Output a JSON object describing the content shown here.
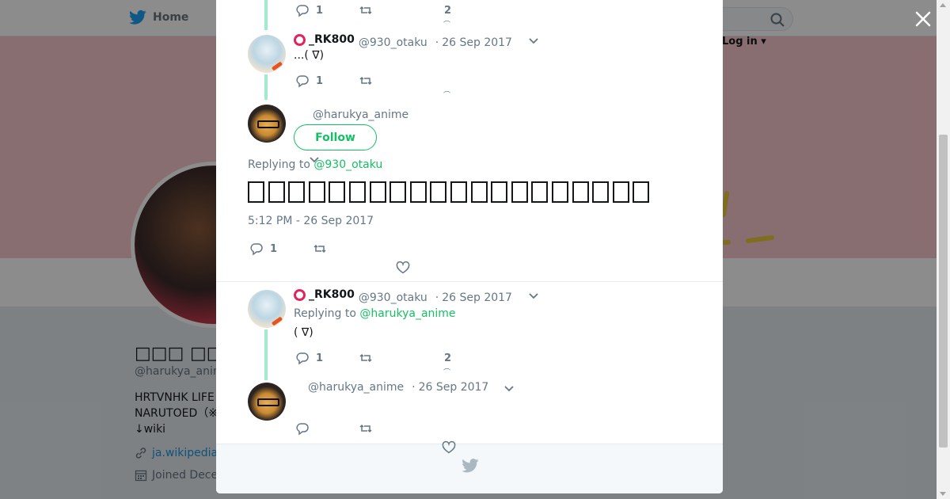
{
  "background": {
    "nav_home": "Home",
    "login": "Log in",
    "profile_name": "□□□ □□",
    "profile_handle": "@harukya_anim",
    "bio_line1": "HRTVNHK LIFE",
    "bio_line2": "NARUTOED（※",
    "bio_line3": "↓wiki",
    "link": "ja.wikipedia",
    "joined": "Joined Dece"
  },
  "thread": {
    "top_reply_count": "1",
    "top_like_count": "2",
    "t1": {
      "name": "_RK800",
      "handle": "@930_otaku",
      "dot": "·",
      "date": "26 Sep 2017",
      "text": "...( ∇)",
      "reply_count": "1"
    },
    "focus": {
      "handle": "@harukya_anime",
      "follow": "Follow",
      "replying_prefix": "Replying to ",
      "replying_to": "@930_otaku",
      "text_glyph_count": 20,
      "time": "5:12 PM - 26 Sep 2017",
      "reply_count": "1"
    },
    "t3": {
      "name": "_RK800",
      "handle": "@930_otaku",
      "dot": "·",
      "date": "26 Sep 2017",
      "replying_prefix": "Replying to ",
      "replying_to": "@harukya_anime",
      "text": "( ∇)",
      "reply_count": "1",
      "like_count": "2"
    },
    "t4": {
      "handle": "@harukya_anime",
      "dot": "·",
      "date": "26 Sep 2017"
    }
  },
  "colors": {
    "accent_green": "#17bf63",
    "link_blue": "#1da1f2",
    "thread_line": "#a0ebc9"
  },
  "icons": [
    "twitter-bird-icon",
    "search-icon",
    "close-icon",
    "reply-icon",
    "retweet-icon",
    "like-icon",
    "chevron-down-icon",
    "link-icon",
    "calendar-icon"
  ]
}
